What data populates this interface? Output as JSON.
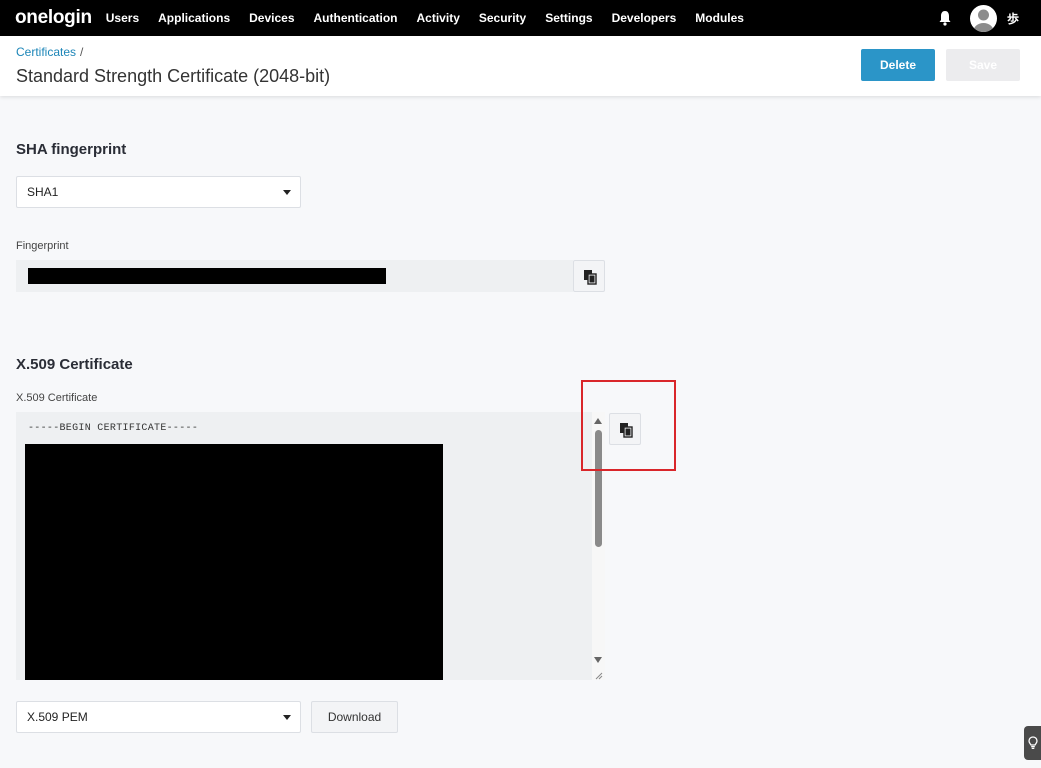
{
  "nav": {
    "logo": "onelogin",
    "items": [
      "Users",
      "Applications",
      "Devices",
      "Authentication",
      "Activity",
      "Security",
      "Settings",
      "Developers",
      "Modules"
    ],
    "username": "歩"
  },
  "header": {
    "breadcrumb": "Certificates",
    "breadcrumb_sep": "/",
    "title": "Standard Strength Certificate (2048-bit)",
    "delete_label": "Delete",
    "save_label": "Save"
  },
  "sha": {
    "section_title": "SHA fingerprint",
    "selected": "SHA1",
    "fingerprint_label": "Fingerprint"
  },
  "x509": {
    "section_title": "X.509 Certificate",
    "field_label": "X.509 Certificate",
    "begin_line": "-----BEGIN CERTIFICATE-----",
    "format_selected": "X.509 PEM",
    "download_label": "Download"
  },
  "colors": {
    "accent": "#2b95c8",
    "nav_bg": "#000000",
    "highlight": "#d9262a"
  }
}
